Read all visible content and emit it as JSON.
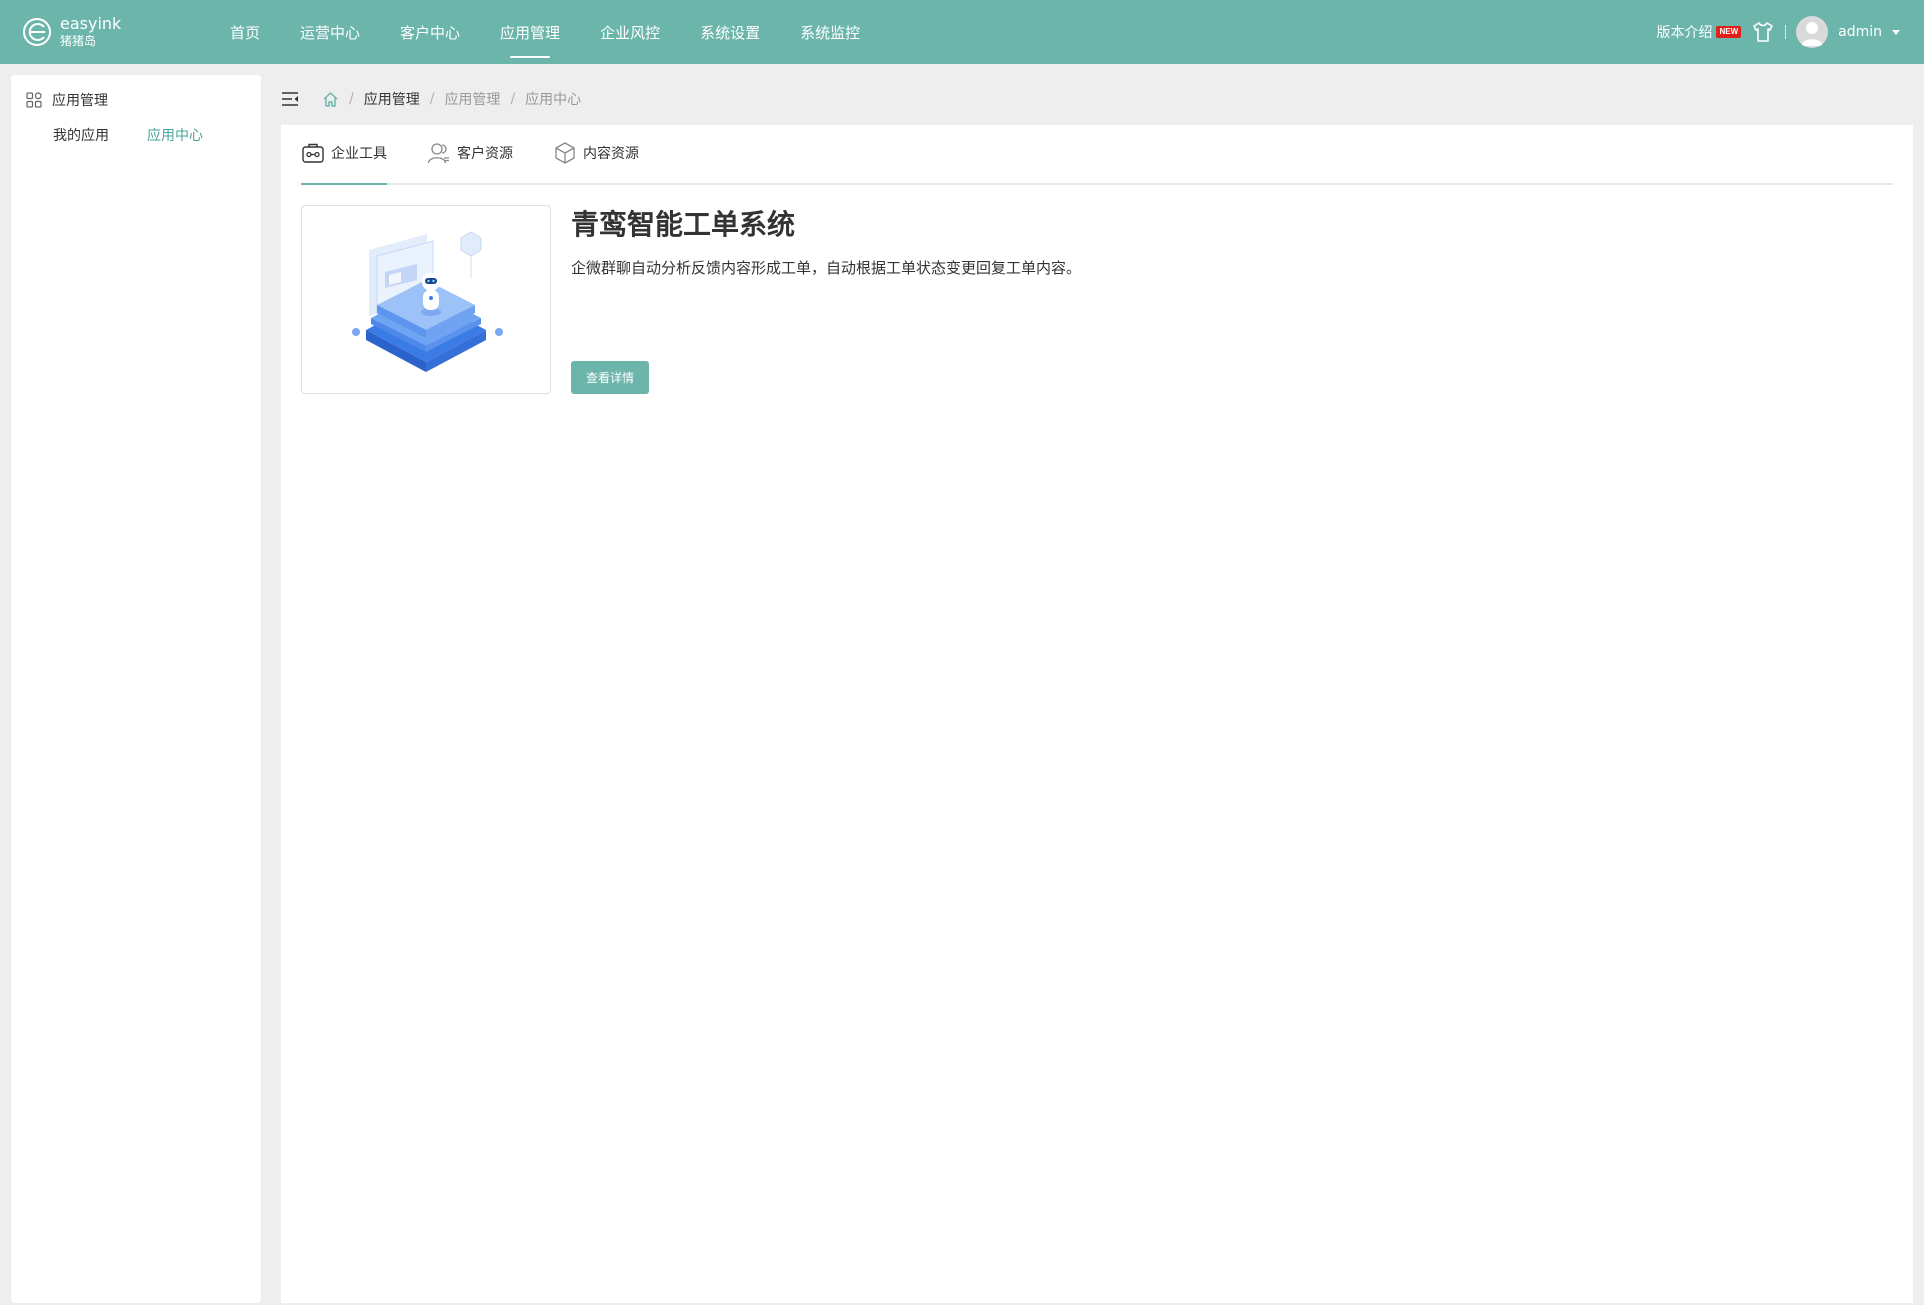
{
  "brand": {
    "name": "easyink",
    "subtitle": "猪猪岛"
  },
  "nav": {
    "items": [
      {
        "label": "首页"
      },
      {
        "label": "运营中心"
      },
      {
        "label": "客户中心"
      },
      {
        "label": "应用管理",
        "active": true
      },
      {
        "label": "企业风控"
      },
      {
        "label": "系统设置"
      },
      {
        "label": "系统监控"
      }
    ]
  },
  "header": {
    "version_label": "版本介绍",
    "new_badge": "NEW",
    "username": "admin"
  },
  "sidebar": {
    "group_label": "应用管理",
    "items": [
      {
        "label": "我的应用"
      },
      {
        "label": "应用中心",
        "active": true
      }
    ]
  },
  "breadcrumb": [
    "应用管理",
    "应用管理",
    "应用中心"
  ],
  "tabs": [
    {
      "label": "企业工具",
      "icon": "toolbox-icon",
      "active": true
    },
    {
      "label": "客户资源",
      "icon": "customers-icon"
    },
    {
      "label": "内容资源",
      "icon": "box-icon"
    }
  ],
  "app": {
    "title": "青鸾智能工单系统",
    "description": "企微群聊自动分析反馈内容形成工单，自动根据工单状态变更回复工单内容。",
    "button_label": "查看详情"
  },
  "colors": {
    "primary": "#6cb5ab",
    "active_text": "#47a69a",
    "badge": "#e0201b"
  }
}
